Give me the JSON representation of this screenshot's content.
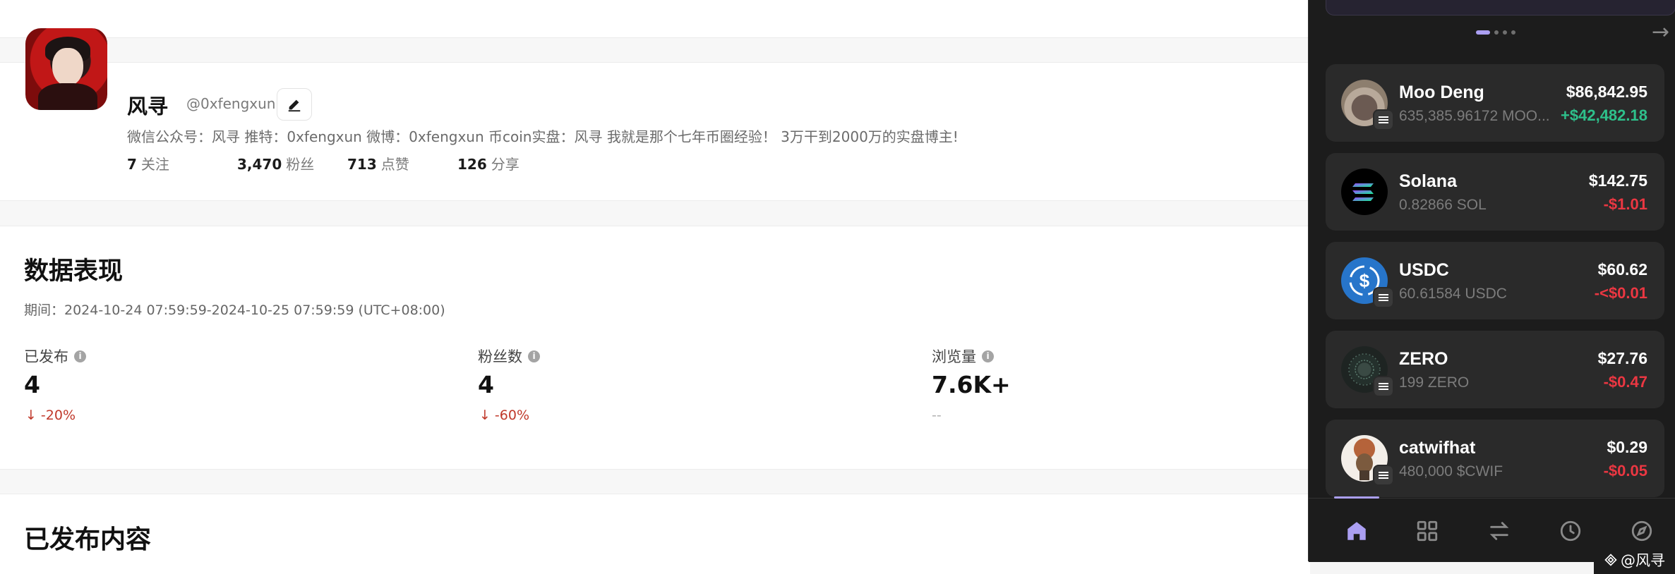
{
  "profile": {
    "name": "风寻",
    "handle": "@0xfengxun",
    "bio": "微信公众号：风寻 推特：0xfengxun 微博：0xfengxun 币coin实盘：风寻 我就是那个七年币圈经验！ 3万干到2000万的实盘博主!",
    "stats": [
      {
        "value": "7",
        "label": "关注"
      },
      {
        "value": "3,470",
        "label": "粉丝"
      },
      {
        "value": "713",
        "label": "点赞"
      },
      {
        "value": "126",
        "label": "分享"
      }
    ]
  },
  "performance": {
    "title": "数据表现",
    "period": "期间：2024-10-24 07:59:59-2024-10-25 07:59:59 (UTC+08:00)",
    "metrics": [
      {
        "label": "已发布",
        "value": "4",
        "delta": "-20%",
        "arrow": "↓"
      },
      {
        "label": "粉丝数",
        "value": "4",
        "delta": "-60%",
        "arrow": "↓"
      },
      {
        "label": "浏览量",
        "value": "7.6K+",
        "delta": "--",
        "arrow": ""
      }
    ]
  },
  "published": {
    "title": "已发布内容"
  },
  "wallet": {
    "next_arrow": "→",
    "tokens": [
      {
        "name": "Moo Deng",
        "amount": "635,385.96172 MOO...",
        "value": "$86,842.95",
        "change": "+$42,482.18",
        "direction": "up"
      },
      {
        "name": "Solana",
        "amount": "0.82866 SOL",
        "value": "$142.75",
        "change": "-$1.01",
        "direction": "down"
      },
      {
        "name": "USDC",
        "amount": "60.61584 USDC",
        "value": "$60.62",
        "change": "-<$0.01",
        "direction": "down"
      },
      {
        "name": "ZERO",
        "amount": "199 ZERO",
        "value": "$27.76",
        "change": "-$0.47",
        "direction": "down"
      },
      {
        "name": "catwifhat",
        "amount": "480,000 $CWIF",
        "value": "$0.29",
        "change": "-$0.05",
        "direction": "down"
      }
    ],
    "nav": [
      "home-icon",
      "apps-grid-icon",
      "swap-icon",
      "history-clock-icon",
      "explore-compass-icon"
    ],
    "accent_color": "#ab9ff2",
    "up_color": "#2ec08b",
    "down_color": "#eb3742"
  },
  "watermark": "@风寻"
}
